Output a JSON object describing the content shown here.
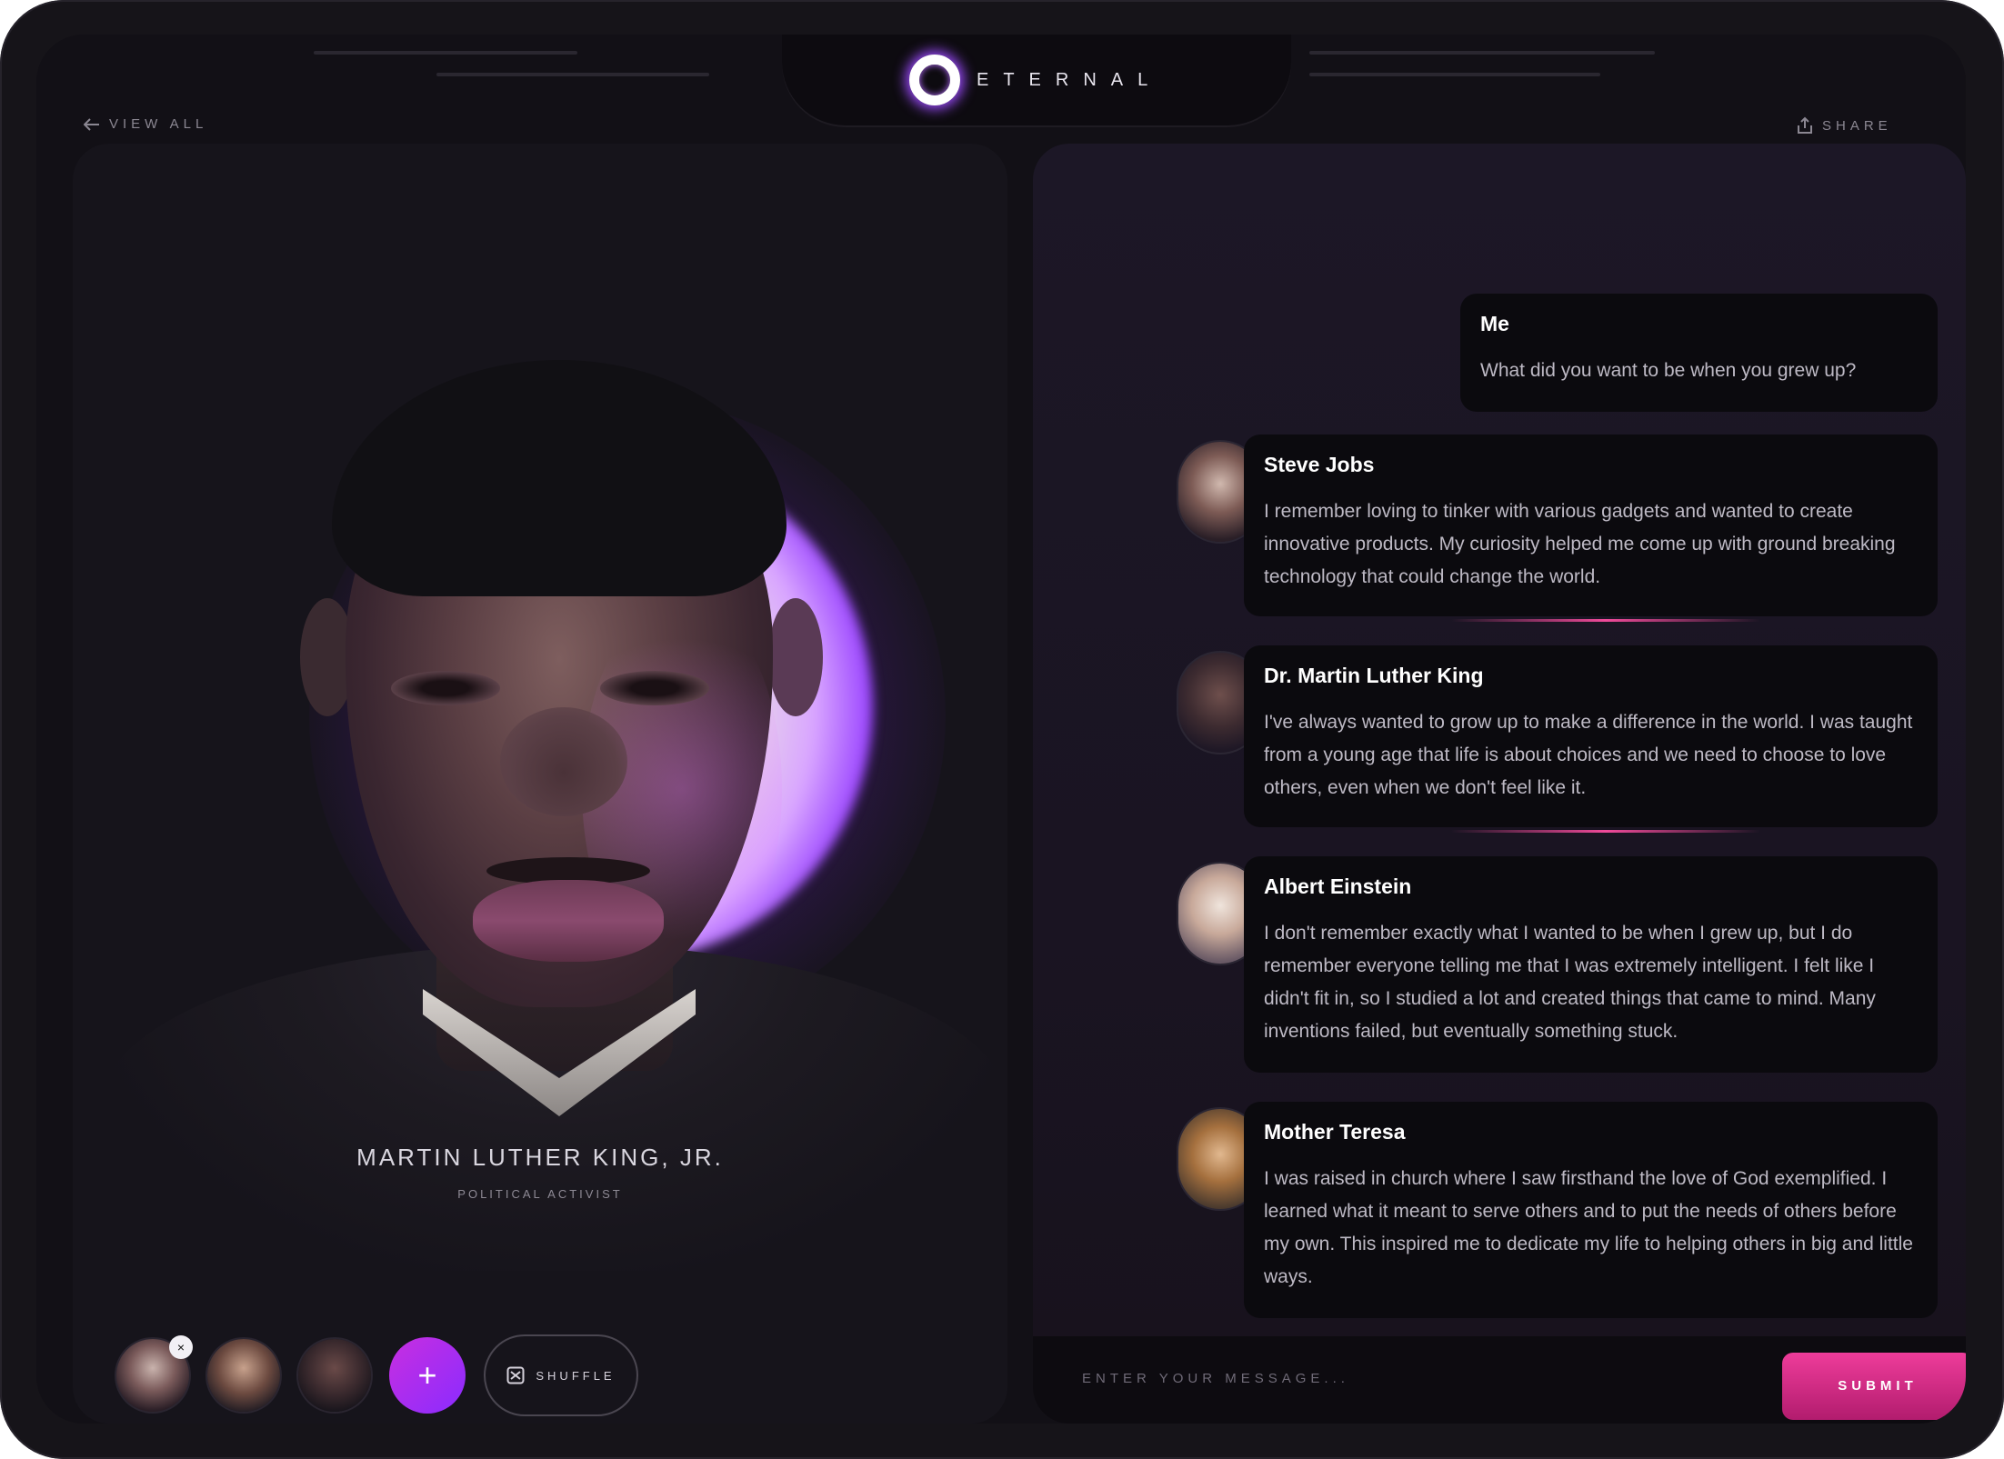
{
  "brand": {
    "name": "ETERNAL"
  },
  "nav": {
    "view_all": "VIEW ALL",
    "share": "SHARE"
  },
  "featured": {
    "name": "MARTIN LUTHER KING, JR.",
    "role": "POLITICAL ACTIVIST"
  },
  "tray": {
    "avatars": [
      {
        "icon": "steve-jobs-avatar",
        "badge": "×"
      },
      {
        "icon": "elon-musk-avatar"
      },
      {
        "icon": "martin-luther-king-avatar"
      }
    ],
    "add_label": "+",
    "shuffle_label": "SHUFFLE"
  },
  "chat": {
    "messages": [
      {
        "author": "Me",
        "text": "What did you want to be when you grew up?"
      },
      {
        "author": "Steve Jobs",
        "text": "I remember loving to tinker with various gadgets and wanted to create innovative products. My curiosity helped me come up with ground breaking technology that could change the world."
      },
      {
        "author": "Dr. Martin Luther King",
        "text": "I've always wanted to grow up to make a difference in the world. I was taught from a young age that life is about choices and we need to choose to love others, even when we don't feel like it."
      },
      {
        "author": "Albert Einstein",
        "text": "I don't remember exactly what I wanted to be when I grew up, but I do remember everyone telling me that I was extremely intelligent. I felt like I didn't fit in, so I studied a lot and created things that came to mind. Many inventions failed, but eventually something stuck."
      },
      {
        "author": "Mother Teresa",
        "text": "I was raised in church where I saw firsthand the love of God exemplified. I learned what it meant to serve others and to put the needs of others before my own. This inspired me to dedicate my life to helping others in big and little ways."
      }
    ],
    "input_placeholder": "ENTER YOUR MESSAGE...",
    "submit_label": "SUBMIT"
  },
  "colors": {
    "accent": "#ee3c9a",
    "purple": "#8a2cff",
    "background": "#121016"
  }
}
